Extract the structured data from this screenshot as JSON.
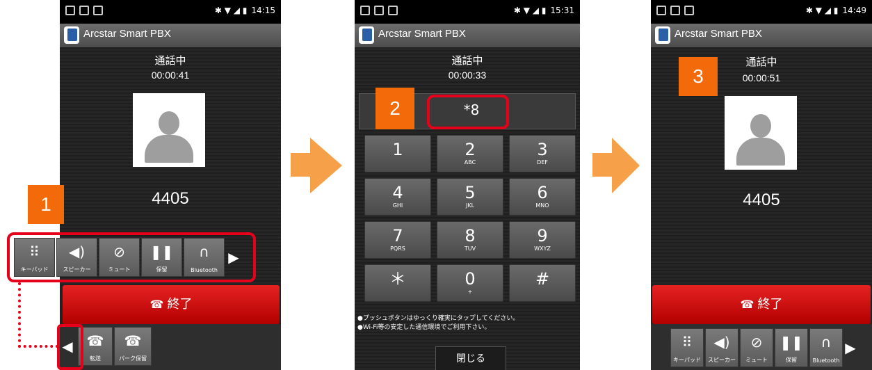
{
  "app_title": "Arcstar Smart PBX",
  "call_status": "通話中",
  "screens": [
    {
      "time": "14:15",
      "timer": "00:00:41",
      "number": "4405",
      "step": "1"
    },
    {
      "time": "15:31",
      "timer": "00:00:33",
      "dial_input": "*8",
      "step": "2"
    },
    {
      "time": "14:49",
      "timer": "00:00:51",
      "number": "4405",
      "step": "3"
    }
  ],
  "toolbar": {
    "keypad": "キーパッド",
    "speaker": "スピーカー",
    "mute": "ミュート",
    "hold": "保留",
    "bluetooth": "Bluetooth"
  },
  "end_call": "終了",
  "sub_toolbar": {
    "transfer": "転送",
    "park_hold": "パーク保留"
  },
  "keypad": [
    {
      "d": "1",
      "l": ""
    },
    {
      "d": "2",
      "l": "ABC"
    },
    {
      "d": "3",
      "l": "DEF"
    },
    {
      "d": "4",
      "l": "GHI"
    },
    {
      "d": "5",
      "l": "JKL"
    },
    {
      "d": "6",
      "l": "MNO"
    },
    {
      "d": "7",
      "l": "PQRS"
    },
    {
      "d": "8",
      "l": "TUV"
    },
    {
      "d": "9",
      "l": "WXYZ"
    },
    {
      "d": "＊",
      "l": ""
    },
    {
      "d": "0",
      "l": "+"
    },
    {
      "d": "#",
      "l": ""
    }
  ],
  "keypad_notes": [
    "●プッシュボタンはゆっくり確実にタップしてください。",
    "●Wi-Fi等の安定した通信環境でご利用下さい。"
  ],
  "close_label": "閉じる",
  "colors": {
    "accent_orange": "#f26a0a",
    "highlight_red": "#e6001a",
    "end_red": "#d40000"
  }
}
